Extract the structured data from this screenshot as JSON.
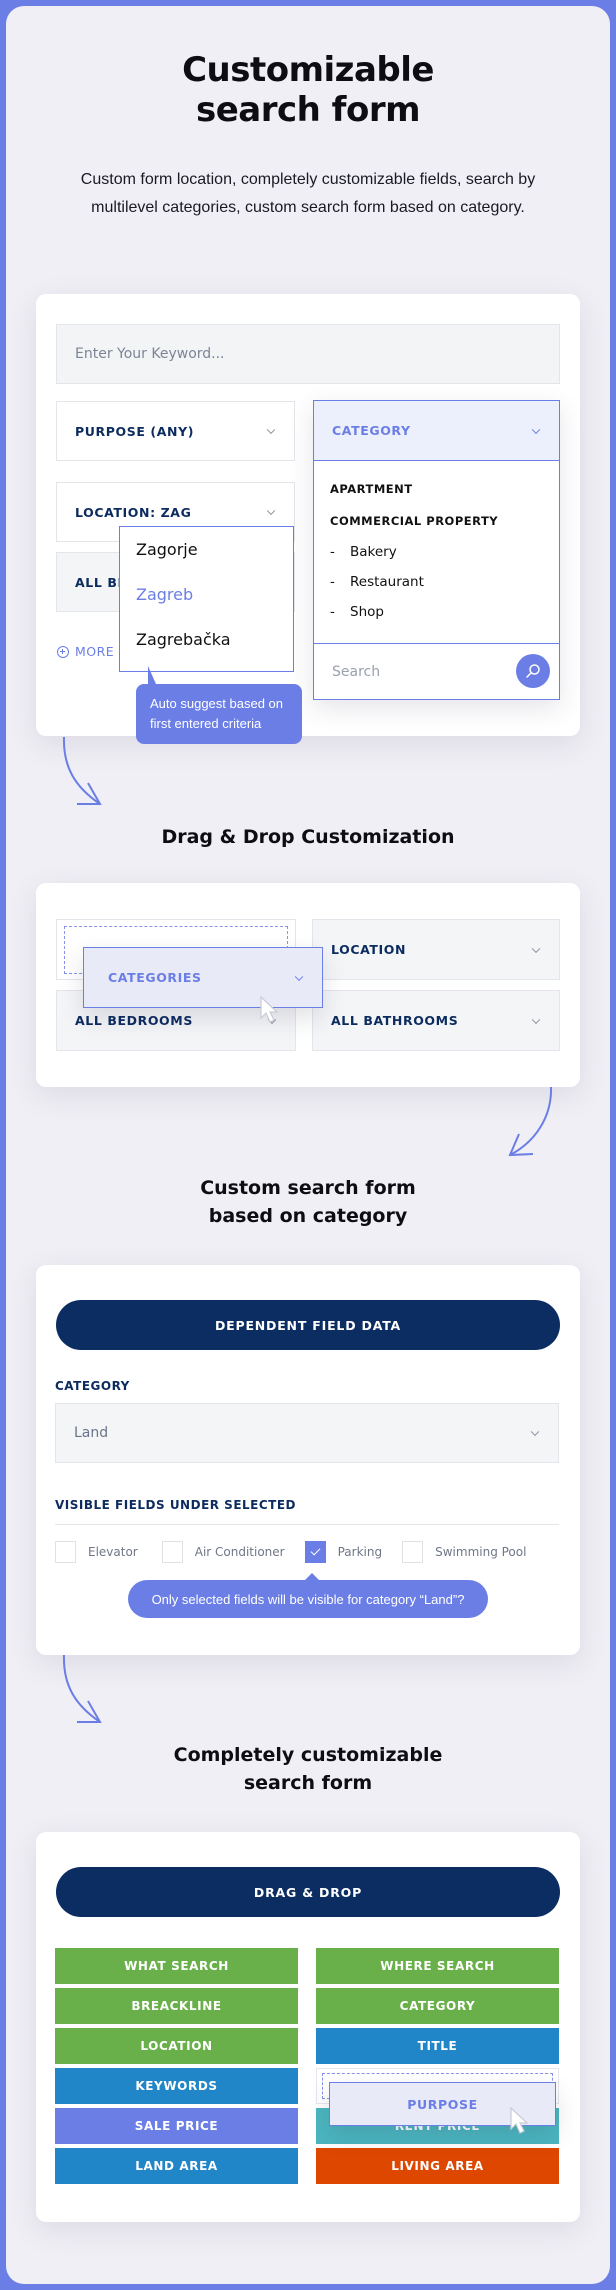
{
  "colors": {
    "accent": "#6b7ee6",
    "navy": "#0b2d61",
    "green": "#6ab04a",
    "blue": "#2186c8",
    "purple": "#6b7ee6",
    "teal": "#4bb6bf",
    "orange": "#de4700"
  },
  "hero": {
    "title_line1": "Customizable",
    "title_line2": "search form",
    "description": "Custom form location, completely customizable fields, search by multilevel categories, custom search form based on category."
  },
  "section1": {
    "keyword_placeholder": "Enter Your Keyword...",
    "purpose_label": "PURPOSE (ANY)",
    "location_label": "LOCATION: ZAG",
    "bedrooms_label": "ALL BE",
    "more_label": "MORE",
    "category": {
      "label": "CATEGORY",
      "groups": [
        "APARTMENT",
        "COMMERCIAL PROPERTY"
      ],
      "subitems": [
        "Bakery",
        "Restaurant",
        "Shop"
      ],
      "sub_prefix": "-",
      "search_placeholder": "Search"
    },
    "suggestions": [
      {
        "label": "Zagorje",
        "active": false
      },
      {
        "label": "Zagreb",
        "active": true
      },
      {
        "label": "Zagrebačka",
        "active": false
      }
    ],
    "tooltip": "Auto suggest based on first entered criteria"
  },
  "section2": {
    "title": "Drag & Drop Customization",
    "dragging_label": "CATEGORIES",
    "location_label": "LOCATION",
    "bedrooms_label": "ALL BEDROOMS",
    "bathrooms_label": "ALL BATHROOMS"
  },
  "section3": {
    "title_line1": "Custom search form",
    "title_line2": "based on category",
    "button_label": "DEPENDENT FIELD DATA",
    "category_label": "CATEGORY",
    "category_value": "Land",
    "visible_fields_label": "VISIBLE FIELDS UNDER SELECTED",
    "checkboxes": [
      {
        "label": "Elevator",
        "checked": false
      },
      {
        "label": "Air Conditioner",
        "checked": false
      },
      {
        "label": "Parking",
        "checked": true
      },
      {
        "label": "Swimming Pool",
        "checked": false
      }
    ],
    "tooltip": "Only selected fields will be visible for category “Land”?"
  },
  "section4": {
    "title_line1": "Completely customizable",
    "title_line2": "search form",
    "button_label": "DRAG & DROP",
    "left_blocks": [
      {
        "label": "WHAT SEARCH",
        "color": "green"
      },
      {
        "label": "BREACKLINE",
        "color": "green"
      },
      {
        "label": "LOCATION",
        "color": "green"
      },
      {
        "label": "KEYWORDS",
        "color": "blue"
      },
      {
        "label": "SALE PRICE",
        "color": "purple"
      },
      {
        "label": "LAND AREA",
        "color": "blue"
      }
    ],
    "right_blocks": [
      {
        "label": "WHERE SEARCH",
        "color": "green"
      },
      {
        "label": "CATEGORY",
        "color": "green"
      },
      {
        "label": "TITLE",
        "color": "blue"
      },
      {
        "label": "",
        "color": "placeholder"
      },
      {
        "label": "RENT PRICE",
        "color": "teal"
      },
      {
        "label": "LIVING AREA",
        "color": "orange"
      }
    ],
    "dragging_label": "PURPOSE"
  }
}
